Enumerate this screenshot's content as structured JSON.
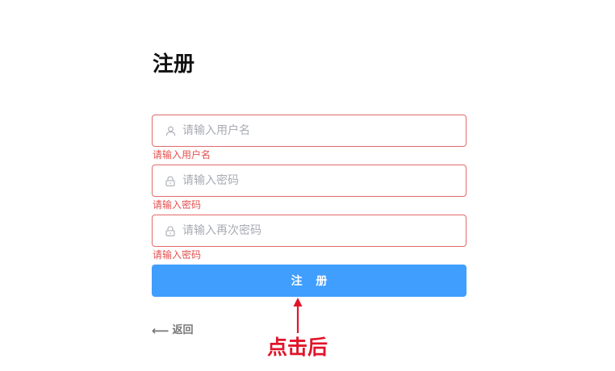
{
  "page": {
    "title": "注册"
  },
  "form": {
    "username": {
      "placeholder": "请输入用户名",
      "value": "",
      "icon": "user-icon",
      "error": "请输入用户名"
    },
    "password": {
      "placeholder": "请输入密码",
      "value": "",
      "icon": "lock-icon",
      "error": "请输入密码"
    },
    "confirm_password": {
      "placeholder": "请输入再次密码",
      "value": "",
      "icon": "lock-icon",
      "error": "请输入密码"
    },
    "submit_label": "注 册",
    "back_label": "返回",
    "back_icon": "arrow-left-icon"
  },
  "annotation": {
    "label": "点击后",
    "icon": "arrow-up-icon",
    "color": "#e0152b"
  },
  "colors": {
    "primary": "#409eff",
    "error": "#e5504f",
    "error_border": "#e26a6a",
    "placeholder": "#a8abb2"
  }
}
